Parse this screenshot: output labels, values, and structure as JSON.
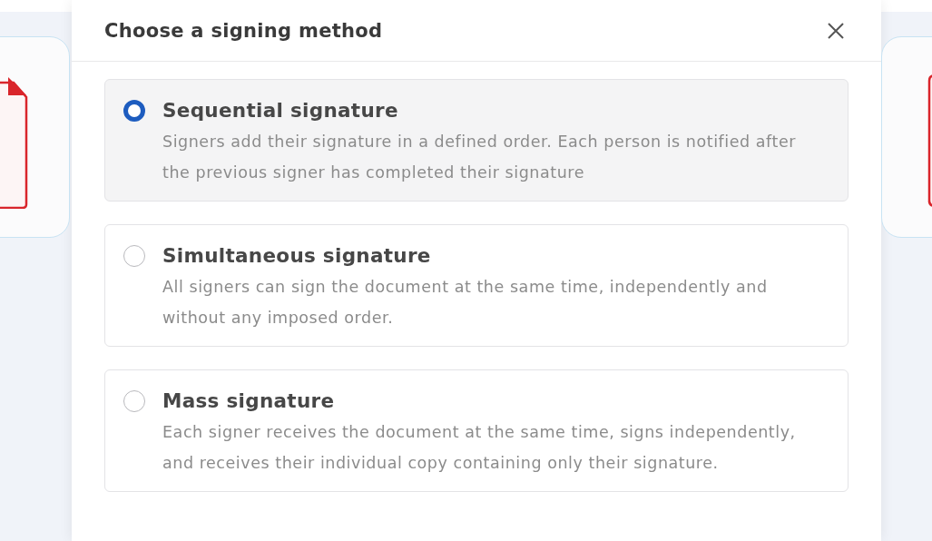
{
  "dialog": {
    "title": "Choose a signing method"
  },
  "options": [
    {
      "title": "Sequential signature",
      "description": "Signers add their signature in a defined order. Each person is notified after the previous signer has completed their signature",
      "selected": true
    },
    {
      "title": "Simultaneous signature",
      "description": "All signers can sign the document at the same time, independently and without any imposed order.",
      "selected": false
    },
    {
      "title": "Mass signature",
      "description": "Each signer receives the document at the same time, signs independently, and receives their individual copy containing only their signature.",
      "selected": false
    }
  ]
}
